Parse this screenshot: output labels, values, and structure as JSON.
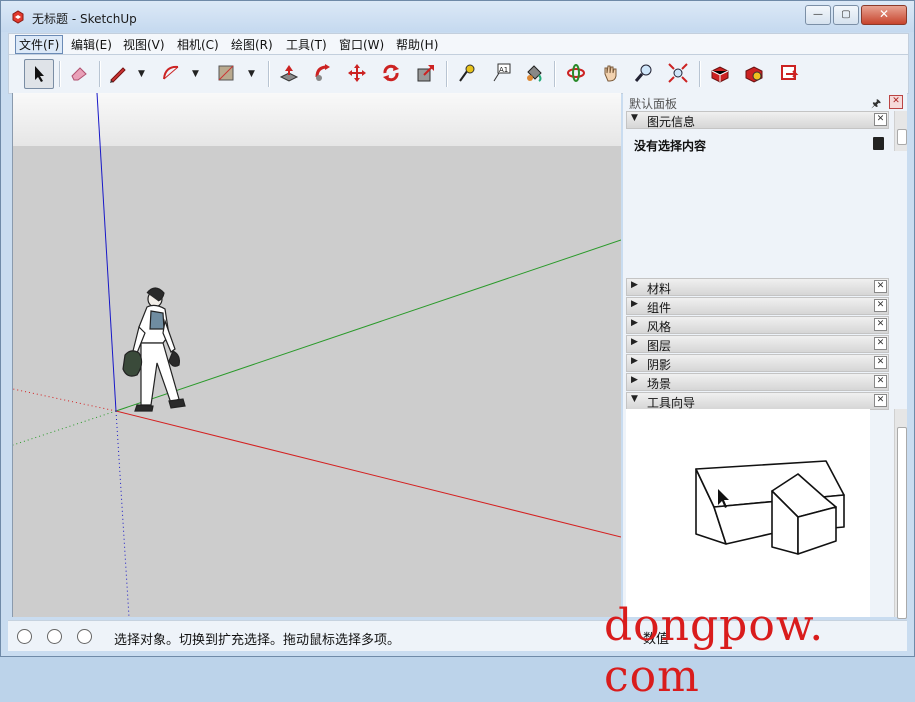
{
  "window": {
    "title": "无标题 - SketchUp",
    "minimize_label": "—",
    "maximize_label": "▢",
    "close_label": "✕"
  },
  "menu": {
    "items": [
      {
        "label": "文件(F)"
      },
      {
        "label": "编辑(E)"
      },
      {
        "label": "视图(V)"
      },
      {
        "label": "相机(C)"
      },
      {
        "label": "绘图(R)"
      },
      {
        "label": "工具(T)"
      },
      {
        "label": "窗口(W)"
      },
      {
        "label": "帮助(H)"
      }
    ]
  },
  "toolbar": {
    "tools": [
      {
        "icon": "select-arrow-icon"
      },
      {
        "icon": "eraser-icon"
      },
      {
        "icon": "pencil-line-icon"
      },
      {
        "icon": "arc-icon"
      },
      {
        "icon": "rectangle-shape-icon"
      },
      {
        "icon": "push-pull-icon"
      },
      {
        "icon": "follow-me-icon"
      },
      {
        "icon": "move-icon"
      },
      {
        "icon": "rotate-icon"
      },
      {
        "icon": "scale-icon"
      },
      {
        "icon": "tape-measure-icon"
      },
      {
        "icon": "text-label-icon"
      },
      {
        "icon": "paint-bucket-icon"
      },
      {
        "icon": "orbit-icon"
      },
      {
        "icon": "pan-hand-icon"
      },
      {
        "icon": "zoom-icon"
      },
      {
        "icon": "zoom-extents-icon"
      },
      {
        "icon": "3d-warehouse-icon"
      },
      {
        "icon": "extension-warehouse-icon"
      },
      {
        "icon": "send-to-layout-icon"
      }
    ],
    "text_tool_glyph": "A1"
  },
  "tray": {
    "title": "默认面板",
    "pin_glyph": "🖈",
    "close_glyph": "✕",
    "entity_info": {
      "label": "图元信息",
      "state": "expanded",
      "body_text": "没有选择内容"
    },
    "sections": [
      {
        "label": "材料",
        "state": "collapsed"
      },
      {
        "label": "组件",
        "state": "collapsed"
      },
      {
        "label": "风格",
        "state": "collapsed"
      },
      {
        "label": "图层",
        "state": "collapsed"
      },
      {
        "label": "阴影",
        "state": "collapsed"
      },
      {
        "label": "场景",
        "state": "collapsed"
      }
    ],
    "instructor": {
      "label": "工具向导",
      "state": "expanded"
    },
    "expanded_arrow": "▼",
    "collapsed_arrow": "▶",
    "x_glyph": "✕"
  },
  "status": {
    "text": "选择对象。切换到扩充选择。拖动鼠标选择多项。",
    "measurements_label": "数值",
    "icons": [
      "geo-location-icon",
      "info-icon",
      "user-icon"
    ]
  },
  "watermark": "dongpow. com",
  "colors": {
    "axis_red": "#d42020",
    "axis_green": "#2a9a2a",
    "axis_blue": "#1818c8",
    "viewport_ground": "#cdcdcd",
    "chrome": "#c9dcf0"
  }
}
